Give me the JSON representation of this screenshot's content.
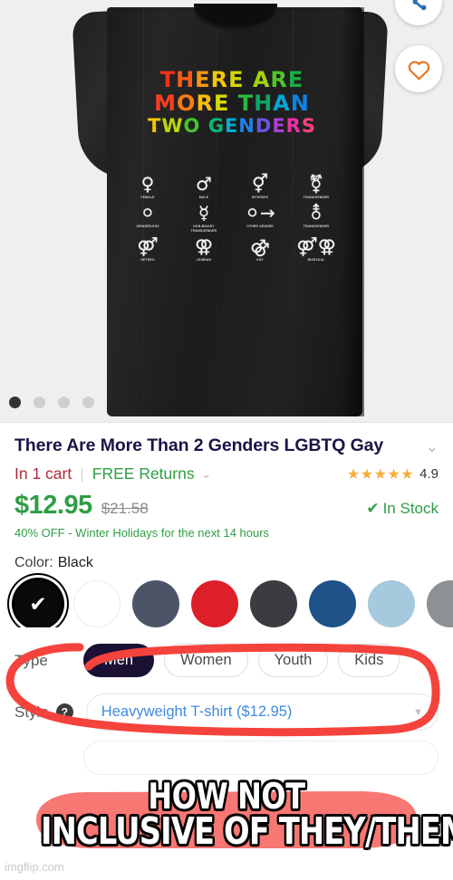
{
  "gallery": {
    "shirt_color_hex": "#1e1e1e",
    "background_hex": "#efefef",
    "design": {
      "lines": [
        {
          "text": "THERE ARE",
          "letters": [
            "T",
            "H",
            "E",
            "R",
            "E",
            " ",
            "A",
            "R",
            "E"
          ],
          "colors": [
            "#d13a2a",
            "#e0622a",
            "#e79a2e",
            "#e8c62f",
            "#cfd32c",
            "#000000",
            "#a9cf33",
            "#5fbf3f",
            "#2fa84f"
          ]
        },
        {
          "text": "MORE THAN",
          "letters": [
            "M",
            "O",
            "R",
            "E",
            " ",
            "T",
            "H",
            "A",
            "N"
          ],
          "colors": [
            "#e2452c",
            "#ef7f2a",
            "#f0bd30",
            "#d8d42c",
            "#000000",
            "#3fb04c",
            "#22a06b",
            "#169fc4",
            "#1f7fd0"
          ]
        },
        {
          "text": "TWO GENDERS",
          "letters": [
            "T",
            "W",
            "O",
            " ",
            "G",
            "E",
            "N",
            "D",
            "E",
            "R",
            "S"
          ],
          "colors": [
            "#e9c32e",
            "#bcd230",
            "#57bd44",
            "#000000",
            "#22b07a",
            "#17a3c4",
            "#2d7ed4",
            "#6a56c8",
            "#9c46bd",
            "#d2399a",
            "#ea4b7a"
          ]
        }
      ],
      "symbols": [
        {
          "glyph": "♀",
          "label": "FEMALE"
        },
        {
          "glyph": "♂",
          "label": "MALE"
        },
        {
          "glyph": "⚥",
          "label": "INTERSEX"
        },
        {
          "glyph": "⚧",
          "label": "TRANSGENDER"
        },
        {
          "glyph": "⚪",
          "label": "GENDERLESS"
        },
        {
          "glyph": "☿",
          "label": "NON-BINARY\nTRANSGENDER"
        },
        {
          "glyph": "⚪→",
          "label": "OTHER GENDER"
        },
        {
          "glyph": "⚨",
          "label": "TRANSGENDER"
        },
        {
          "glyph": "⚤",
          "label": "HETERO"
        },
        {
          "glyph": "⚢",
          "label": "LESBIAN"
        },
        {
          "glyph": "⚣",
          "label": "GAY"
        },
        {
          "glyph": "⚤⚢",
          "label": "BISEXUAL"
        }
      ]
    },
    "share_button": {
      "icon": "share-icon",
      "color": "#2a6fb0"
    },
    "like_button": {
      "icon": "heart-icon",
      "color": "#e8761f"
    },
    "carousel_dots": [
      {
        "active": true
      },
      {
        "active": false
      },
      {
        "active": false
      },
      {
        "active": false
      }
    ]
  },
  "product": {
    "title": "There Are More Than 2 Genders LGBTQ Gay",
    "title_chevron": "⌄",
    "cart_status": "In 1 cart",
    "divider": "|",
    "free_returns": "FREE Returns",
    "returns_chevron": "⌄",
    "rating_stars": "★★★★★",
    "rating_value": "4.9",
    "price": "$12.95",
    "old_price": "$21.58",
    "stock_tick": "✔",
    "stock_text": "In Stock",
    "promo": "40% OFF - Winter Holidays for the next 14 hours"
  },
  "color_option": {
    "label": "Color:",
    "selected_name": "Black",
    "check_glyph": "✔",
    "swatches": [
      {
        "name": "Black",
        "hex": "#0a0a0a",
        "selected": true
      },
      {
        "name": "White",
        "hex": "#ffffff",
        "selected": false
      },
      {
        "name": "Slate",
        "hex": "#4c5568",
        "selected": false
      },
      {
        "name": "Red",
        "hex": "#dd1f28",
        "selected": false
      },
      {
        "name": "Charcoal",
        "hex": "#3a3c41",
        "selected": false
      },
      {
        "name": "Navy",
        "hex": "#1e5289",
        "selected": false
      },
      {
        "name": "Light Blue",
        "hex": "#a5cade",
        "selected": false
      },
      {
        "name": "Grey",
        "hex": "#8e9194",
        "selected": false
      }
    ]
  },
  "type_option": {
    "label": "Type",
    "choices": [
      {
        "label": "Men",
        "selected": true
      },
      {
        "label": "Women",
        "selected": false
      },
      {
        "label": "Youth",
        "selected": false
      },
      {
        "label": "Kids",
        "selected": false
      }
    ]
  },
  "style_option": {
    "label": "Style",
    "help_glyph": "?",
    "value": "Heavyweight T-shirt ($12.95)",
    "caret": "▼"
  },
  "annotation": {
    "color": "#f4433c",
    "shape": "hand-drawn-oval-around-type-row"
  },
  "caption": {
    "line1": "HOW NOT",
    "line2": "INCLUSIVE OF THEY/THEM"
  },
  "watermark": "imgflip.com"
}
